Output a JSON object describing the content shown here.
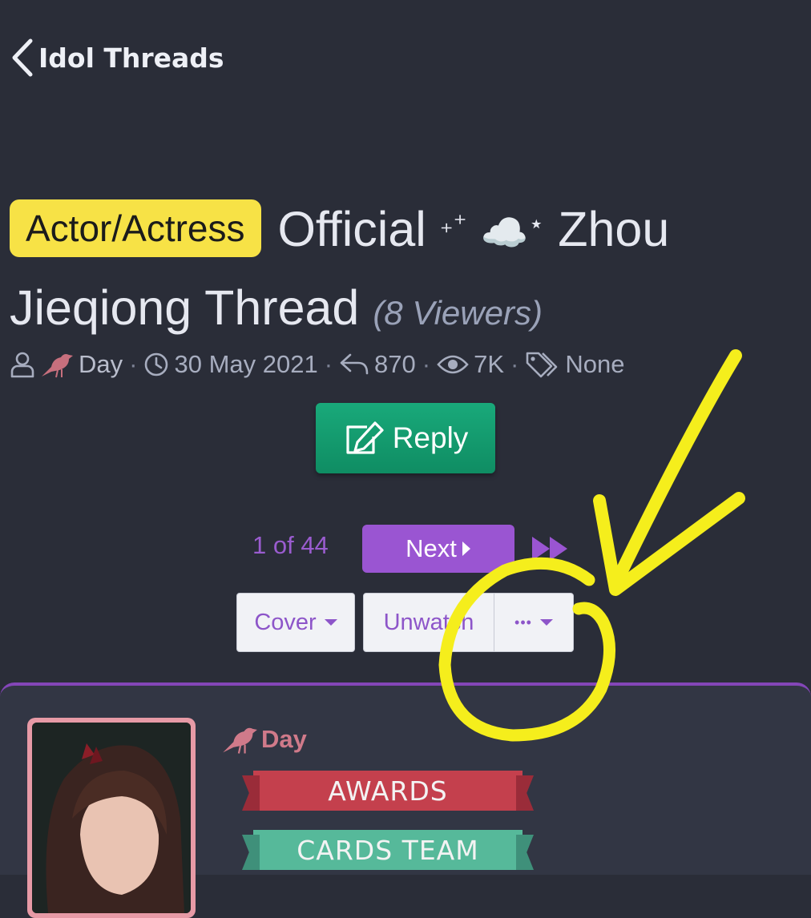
{
  "header": {
    "back_label": "Idol Threads"
  },
  "thread": {
    "prefix": "Actor/Actress",
    "title_part1": "Official",
    "sparkle1": "₊⁺",
    "cloud": "☁️",
    "sparkle2": "⋆",
    "title_part2": "Zhou Jieqiong Thread",
    "viewers": "(8 Viewers)"
  },
  "meta": {
    "author": "Day",
    "date": "30 May 2021",
    "replies": "870",
    "views": "7K",
    "tags": "None",
    "separator": "·"
  },
  "actions": {
    "reply_label": "Reply"
  },
  "pagination": {
    "page_info": "1 of 44",
    "next_label": "Next"
  },
  "toolbar": {
    "cover_label": "Cover",
    "unwatch_label": "Unwatch",
    "more_label": "•••"
  },
  "post": {
    "author": "Day",
    "banners": [
      "AWARDS",
      "CARDS TEAM"
    ]
  },
  "colors": {
    "background": "#2a2d38",
    "prefix_badge": "#f7e246",
    "reply_button": "#129a6e",
    "accent_purple": "#9a55d2",
    "author_pink": "#d07a8a",
    "annotation_yellow": "#f5ee1c"
  },
  "icons": {
    "back": "chevron-left-icon",
    "user": "user-icon",
    "bird": "bird-icon",
    "clock": "clock-icon",
    "reply": "reply-arrow-icon",
    "eye": "eye-icon",
    "tag": "tags-icon",
    "edit": "edit-icon",
    "next": "caret-right-icon",
    "last": "fast-forward-icon"
  }
}
